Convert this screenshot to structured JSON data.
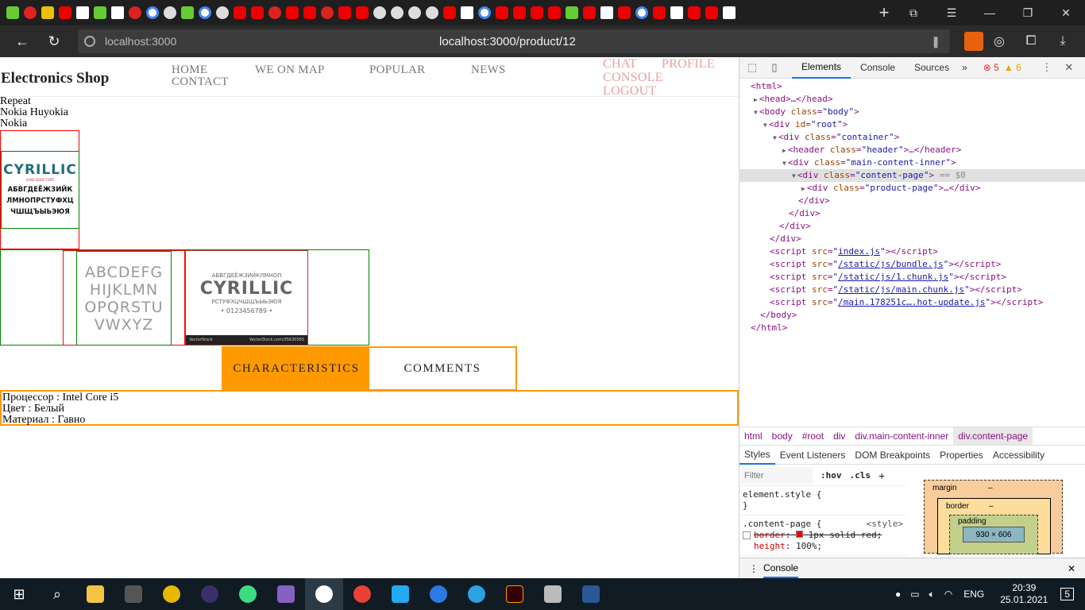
{
  "browser": {
    "address_host": "localhost:3000",
    "address_url": "localhost:3000/product/12",
    "new_tab_label": "+"
  },
  "site": {
    "brand": "Electronics Shop",
    "nav_main": [
      "HOME",
      "WE ON MAP",
      "POPULAR",
      "NEWS",
      "CONTACT"
    ],
    "nav_right": [
      "CHAT",
      "PROFILE",
      "CONSOLE",
      "LOGOUT"
    ]
  },
  "product": {
    "lines": [
      "Repeat",
      "Nokia Huyokia",
      "Nokia"
    ],
    "main_image": {
      "title": "CYRILLIC",
      "sub": "SANS SERIF FONT",
      "rows": [
        "АБВГДЕЁЖЗИЙК",
        "ЛМНОПРСТУФХЦ",
        "ЧШЩЪЫЬЭЮЯ"
      ]
    },
    "thumb1": {
      "rows": [
        "ABCDEFG",
        "HIJKLMN",
        "OPQRSTU",
        "VWXYZ"
      ]
    },
    "thumb2": {
      "top": "АБВГДЕЁЖЗИЙКЛМНОП",
      "title": "CYRILLIC",
      "rows": [
        "РСТУФХЦЧШЩЪЫЬЭЮЯ",
        "• 0123456789 •"
      ],
      "footer_left": "VectorStock",
      "footer_right": "VectorStock.com/35630583"
    },
    "tabs": [
      "CHARACTERISTICS",
      "COMMENTS"
    ],
    "characteristics": [
      "Процессор : Intel Core i5",
      "Цвет : Белый",
      "Материал : Гавно"
    ]
  },
  "devtools": {
    "tabs": [
      "Elements",
      "Console",
      "Sources"
    ],
    "more_tabs": "»",
    "errors": "5",
    "warnings": "6",
    "dom": {
      "html_open": "<html>",
      "head": "<head>…</head>",
      "body_tag": "body",
      "body_class": "body",
      "root_id": "root",
      "container_class": "container",
      "header_class": "header",
      "main_class": "main-content-inner",
      "content_class": "content-page",
      "eq_label": "== $0",
      "product_class": "product-page",
      "close_div": "</div>",
      "scripts": [
        "index.js",
        "/static/js/bundle.js",
        "/static/js/1.chunk.js",
        "/static/js/main.chunk.js",
        "/main.178251c….hot-update.js"
      ],
      "body_close": "</body>",
      "html_close": "</html>"
    },
    "breadcrumbs": [
      "html",
      "body",
      "#root",
      "div",
      "div.main-content-inner",
      "div.content-page"
    ],
    "style_tabs": [
      "Styles",
      "Event Listeners",
      "DOM Breakpoints",
      "Properties",
      "Accessibility"
    ],
    "filter_placeholder": "Filter",
    "hov_label": ":hov",
    "cls_label": ".cls",
    "element_style": "element.style {",
    "close_brace": "}",
    "rule_selector": ".content-page {",
    "rule_source": "<style>",
    "rule_props": [
      {
        "name": "border",
        "value": "1px solid red;"
      },
      {
        "name": "height",
        "value": "100%;"
      }
    ],
    "box_model": {
      "margin": "margin",
      "border": "border",
      "padding": "padding",
      "content": "930 × 606",
      "dash": "–"
    },
    "drawer_label": "Console"
  },
  "taskbar": {
    "lang": "ENG",
    "time": "20:39",
    "date": "25.01.2021",
    "notifications": "5"
  }
}
